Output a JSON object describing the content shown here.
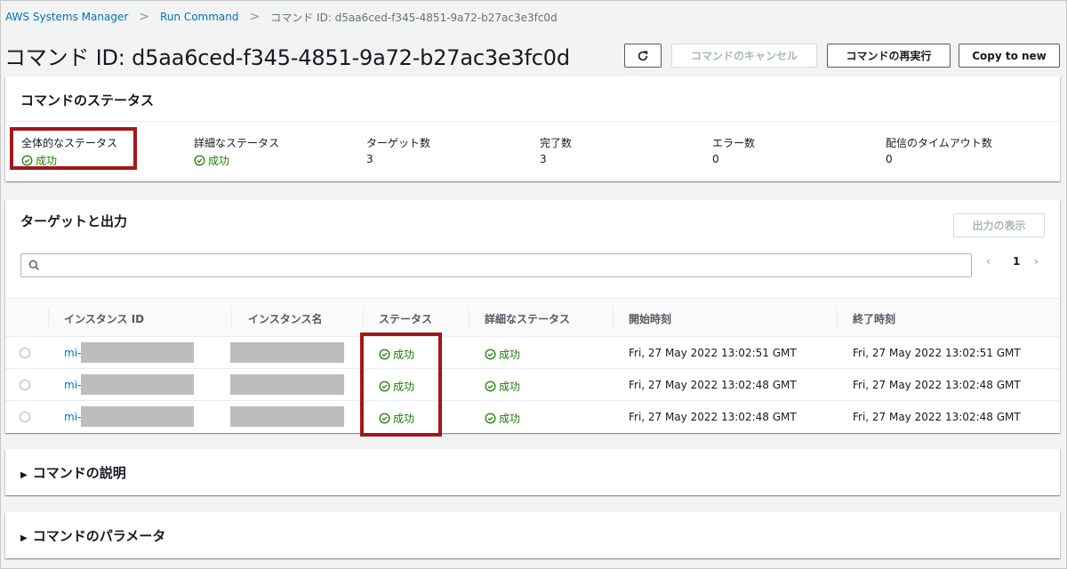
{
  "breadcrumb": {
    "items": [
      "AWS Systems Manager",
      "Run Command"
    ],
    "current": "コマンド ID: d5aa6ced-f345-4851-9a72-b27ac3e3fc0d"
  },
  "page_title": "コマンド ID: d5aa6ced-f345-4851-9a72-b27ac3e3fc0d",
  "actions": {
    "cancel": "コマンドのキャンセル",
    "rerun": "コマンドの再実行",
    "copy": "Copy to new"
  },
  "status_panel": {
    "title": "コマンドのステータス",
    "stats": [
      {
        "label": "全体的なステータス",
        "value": "成功",
        "type": "status"
      },
      {
        "label": "詳細なステータス",
        "value": "成功",
        "type": "status"
      },
      {
        "label": "ターゲット数",
        "value": "3",
        "type": "number"
      },
      {
        "label": "完了数",
        "value": "3",
        "type": "number"
      },
      {
        "label": "エラー数",
        "value": "0",
        "type": "number"
      },
      {
        "label": "配信のタイムアウト数",
        "value": "0",
        "type": "number"
      }
    ]
  },
  "targets_panel": {
    "title": "ターゲットと出力",
    "show_output": "出力の表示",
    "search_placeholder": "",
    "pager": {
      "prev": "‹",
      "page": "1",
      "next": "›"
    },
    "columns": [
      "インスタンス ID",
      "インスタンス名",
      "ステータス",
      "詳細なステータス",
      "開始時刻",
      "終了時刻"
    ],
    "rows": [
      {
        "instance_id": "mi-",
        "status": "成功",
        "detail_status": "成功",
        "start": "Fri, 27 May 2022 13:02:51 GMT",
        "end": "Fri, 27 May 2022 13:02:51 GMT"
      },
      {
        "instance_id": "mi-",
        "status": "成功",
        "detail_status": "成功",
        "start": "Fri, 27 May 2022 13:02:48 GMT",
        "end": "Fri, 27 May 2022 13:02:48 GMT"
      },
      {
        "instance_id": "mi-",
        "status": "成功",
        "detail_status": "成功",
        "start": "Fri, 27 May 2022 13:02:48 GMT",
        "end": "Fri, 27 May 2022 13:02:48 GMT"
      }
    ]
  },
  "sections": {
    "description": "コマンドの説明",
    "parameters": "コマンドのパラメータ"
  },
  "colors": {
    "link": "#0073bb",
    "success": "#1d8102",
    "highlight": "#a4161a"
  }
}
